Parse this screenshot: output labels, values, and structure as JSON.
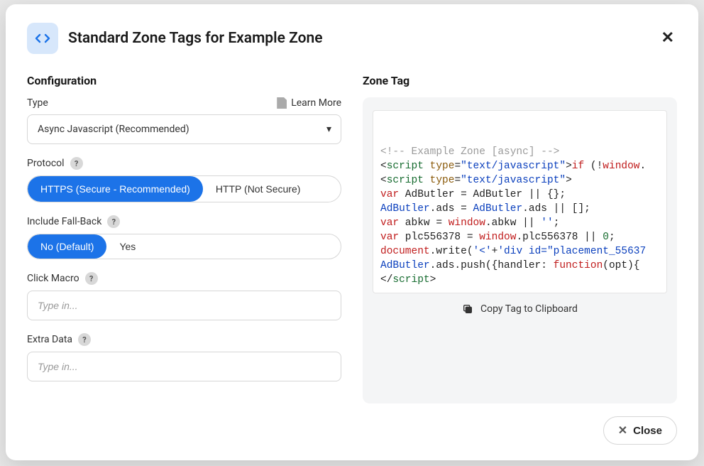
{
  "header": {
    "title": "Standard Zone Tags for Example Zone"
  },
  "left": {
    "section_title": "Configuration",
    "type_label": "Type",
    "learn_more": "Learn More",
    "type_value": "Async Javascript (Recommended)",
    "protocol_label": "Protocol",
    "protocol_options": {
      "https": "HTTPS (Secure - Recommended)",
      "http": "HTTP (Not Secure)"
    },
    "fallback_label": "Include Fall-Back",
    "fallback_options": {
      "no": "No (Default)",
      "yes": "Yes"
    },
    "click_macro_label": "Click Macro",
    "click_macro_placeholder": "Type in...",
    "extra_data_label": "Extra Data",
    "extra_data_placeholder": "Type in..."
  },
  "right": {
    "section_title": "Zone Tag",
    "copy_label": "Copy Tag to Clipboard",
    "code": {
      "l1_comment": "<!-- Example Zone [async] -->",
      "l2_open": "<",
      "l2_tag": "script",
      "l2_sp": " ",
      "l2_attr": "type",
      "l2_eq": "=",
      "l2_val": "\"text/javascript\"",
      "l2_close": ">",
      "l2_kw": "if",
      "l2_paren": " (!",
      "l2_win": "window",
      "l2_dot": ".",
      "l3_open": "<",
      "l3_tag": "script",
      "l3_sp": " ",
      "l3_attr": "type",
      "l3_eq": "=",
      "l3_val": "\"text/javascript\"",
      "l3_close": ">",
      "l4_kw": "var",
      "l4_a": " AdButler = AdButler || {};",
      "l5_a": "AdButler",
      "l5_b": ".ads = ",
      "l5_c": "AdButler",
      "l5_d": ".ads || [];",
      "l6_kw": "var",
      "l6_a": " abkw = ",
      "l6_b": "window",
      "l6_c": ".abkw || ",
      "l6_d": "''",
      "l6_e": ";",
      "l7_kw": "var",
      "l7_a": " plc556378 = ",
      "l7_b": "window",
      "l7_c": ".plc556378 || ",
      "l7_d": "0",
      "l7_e": ";",
      "l8_a": "document",
      "l8_b": ".write(",
      "l8_c": "'<'",
      "l8_d": "+",
      "l8_e": "'div id=\"placement_55637",
      "l9_a": "AdButler",
      "l9_b": ".ads.push({handler: ",
      "l9_c": "function",
      "l9_d": "(opt){",
      "l10_open": "</",
      "l10_tag": "script",
      "l10_close": ">"
    }
  },
  "footer": {
    "close": "Close"
  }
}
